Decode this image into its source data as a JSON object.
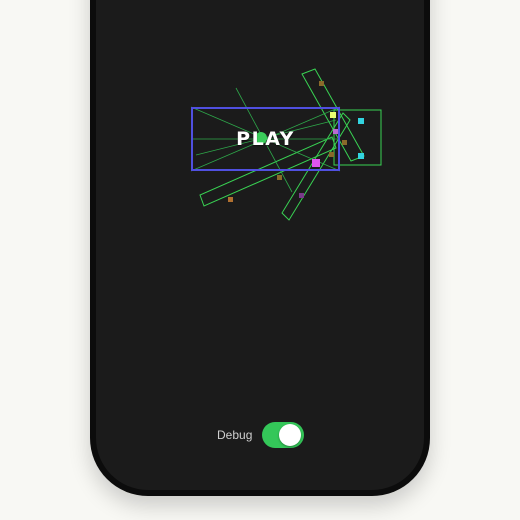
{
  "play_button": {
    "label": "PLAY"
  },
  "debug": {
    "label": "Debug",
    "enabled": true
  },
  "colors": {
    "debug_outline": "#39d353",
    "button_outline": "#5050e0",
    "toggle_on": "#34c759",
    "screen_background": "#1b1b1b"
  }
}
